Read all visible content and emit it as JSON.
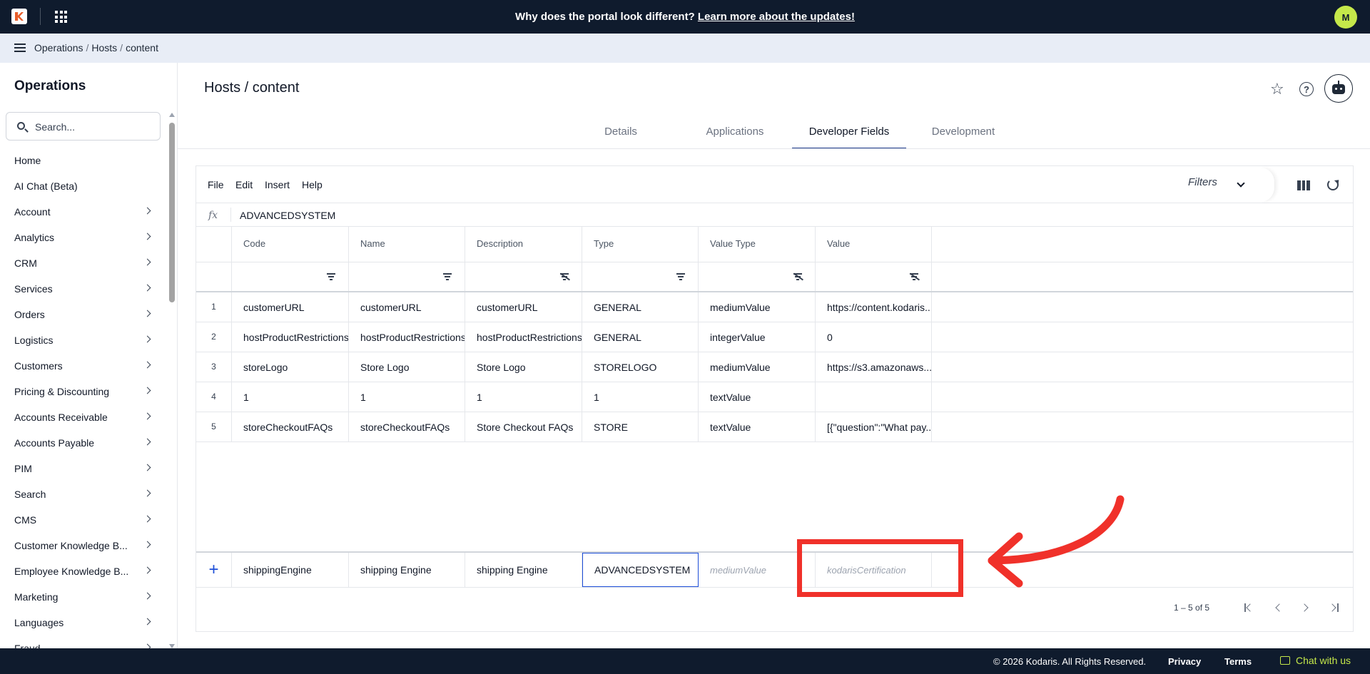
{
  "topbar": {
    "announcement": "Why does the portal look different?",
    "announcement_link": "Learn more about the updates!",
    "avatar_initial": "M"
  },
  "breadcrumb": [
    "Operations",
    "Hosts",
    "content"
  ],
  "sidebar": {
    "title": "Operations",
    "search_placeholder": "Search...",
    "items": [
      {
        "label": "Home",
        "chevron": false
      },
      {
        "label": "AI Chat (Beta)",
        "chevron": false
      },
      {
        "label": "Account",
        "chevron": true
      },
      {
        "label": "Analytics",
        "chevron": true
      },
      {
        "label": "CRM",
        "chevron": true
      },
      {
        "label": "Services",
        "chevron": true
      },
      {
        "label": "Orders",
        "chevron": true
      },
      {
        "label": "Logistics",
        "chevron": true
      },
      {
        "label": "Customers",
        "chevron": true
      },
      {
        "label": "Pricing & Discounting",
        "chevron": true
      },
      {
        "label": "Accounts Receivable",
        "chevron": true
      },
      {
        "label": "Accounts Payable",
        "chevron": true
      },
      {
        "label": "PIM",
        "chevron": true
      },
      {
        "label": "Search",
        "chevron": true
      },
      {
        "label": "CMS",
        "chevron": true
      },
      {
        "label": "Customer Knowledge B...",
        "chevron": true
      },
      {
        "label": "Employee Knowledge B...",
        "chevron": true
      },
      {
        "label": "Marketing",
        "chevron": true
      },
      {
        "label": "Languages",
        "chevron": true
      },
      {
        "label": "Fraud",
        "chevron": true
      }
    ]
  },
  "page": {
    "title": "Hosts / content",
    "tabs": [
      {
        "label": "Details",
        "active": false
      },
      {
        "label": "Applications",
        "active": false
      },
      {
        "label": "Developer Fields",
        "active": true
      },
      {
        "label": "Development",
        "active": false
      }
    ]
  },
  "grid": {
    "menu": [
      "File",
      "Edit",
      "Insert",
      "Help"
    ],
    "filters_label": "Filters",
    "fx_label": "fx",
    "fx_value": "ADVANCEDSYSTEM",
    "columns": [
      "Code",
      "Name",
      "Description",
      "Type",
      "Value Type",
      "Value"
    ],
    "rows": [
      {
        "num": "1",
        "cells": [
          "customerURL",
          "customerURL",
          "customerURL",
          "GENERAL",
          "mediumValue",
          "https://content.kodaris...."
        ]
      },
      {
        "num": "2",
        "cells": [
          "hostProductRestrictions",
          "hostProductRestrictions",
          "hostProductRestrictions",
          "GENERAL",
          "integerValue",
          "0"
        ]
      },
      {
        "num": "3",
        "cells": [
          "storeLogo",
          "Store Logo",
          "Store Logo",
          "STORELOGO",
          "mediumValue",
          "https://s3.amazonaws...."
        ]
      },
      {
        "num": "4",
        "cells": [
          "1",
          "1",
          "1",
          "1",
          "textValue",
          ""
        ]
      },
      {
        "num": "5",
        "cells": [
          "storeCheckoutFAQs",
          "storeCheckoutFAQs",
          "Store Checkout FAQs",
          "STORE",
          "textValue",
          "[{\"question\":\"What pay..."
        ]
      }
    ],
    "new_row": {
      "plus": "+",
      "code": "shippingEngine",
      "name": "shipping Engine",
      "description": "shipping Engine",
      "type": "ADVANCEDSYSTEM",
      "value_type_placeholder": "mediumValue",
      "value_placeholder": "kodarisCertification"
    },
    "pagination": "1 – 5 of 5"
  },
  "annotation": {
    "color": "#f0312a"
  },
  "footer": {
    "copyright": "© 2026 Kodaris. All Rights Reserved.",
    "privacy": "Privacy",
    "terms": "Terms",
    "chat": "Chat with us"
  }
}
